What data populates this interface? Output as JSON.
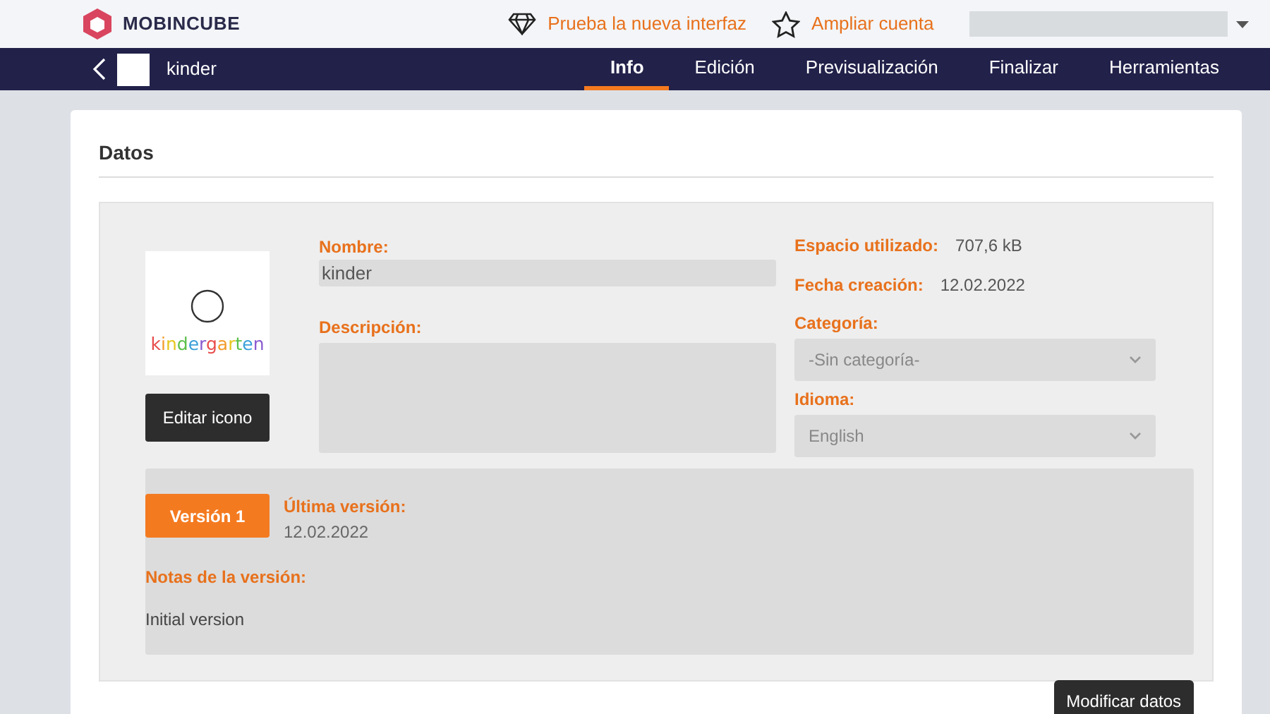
{
  "header": {
    "brand": "MOBINCUBE",
    "links": [
      {
        "label": "Prueba la nueva interfaz",
        "kind": "diamond"
      },
      {
        "label": "Ampliar cuenta",
        "kind": "star"
      }
    ]
  },
  "nav": {
    "app_name": "kinder",
    "tabs": [
      {
        "label": "Info",
        "selected": true
      },
      {
        "label": "Edición",
        "selected": false
      },
      {
        "label": "Previsualización",
        "selected": false
      },
      {
        "label": "Finalizar",
        "selected": false
      },
      {
        "label": "Herramientas",
        "selected": false
      }
    ]
  },
  "section_title": "Datos",
  "app_icon": {
    "text": "kindergarten",
    "button": "Editar icono"
  },
  "fields": {
    "name_label": "Nombre:",
    "name_value": "kinder",
    "description_label": "Descripción:"
  },
  "stats": [
    {
      "label": "Espacio utilizado:",
      "value": "707,6 kB"
    },
    {
      "label": "Fecha creación:",
      "value": "12.02.2022"
    }
  ],
  "selects": [
    {
      "label": "Categoría:",
      "value": "-Sin categoría-"
    },
    {
      "label": "Idioma:",
      "value": "English"
    }
  ],
  "version": {
    "badge": "Versión 1",
    "latest_label": "Última versión:",
    "latest_date": "12.02.2022",
    "notes_label": "Notas de la versión:",
    "notes": "Initial version"
  },
  "submit_button": "Modificar datos"
}
